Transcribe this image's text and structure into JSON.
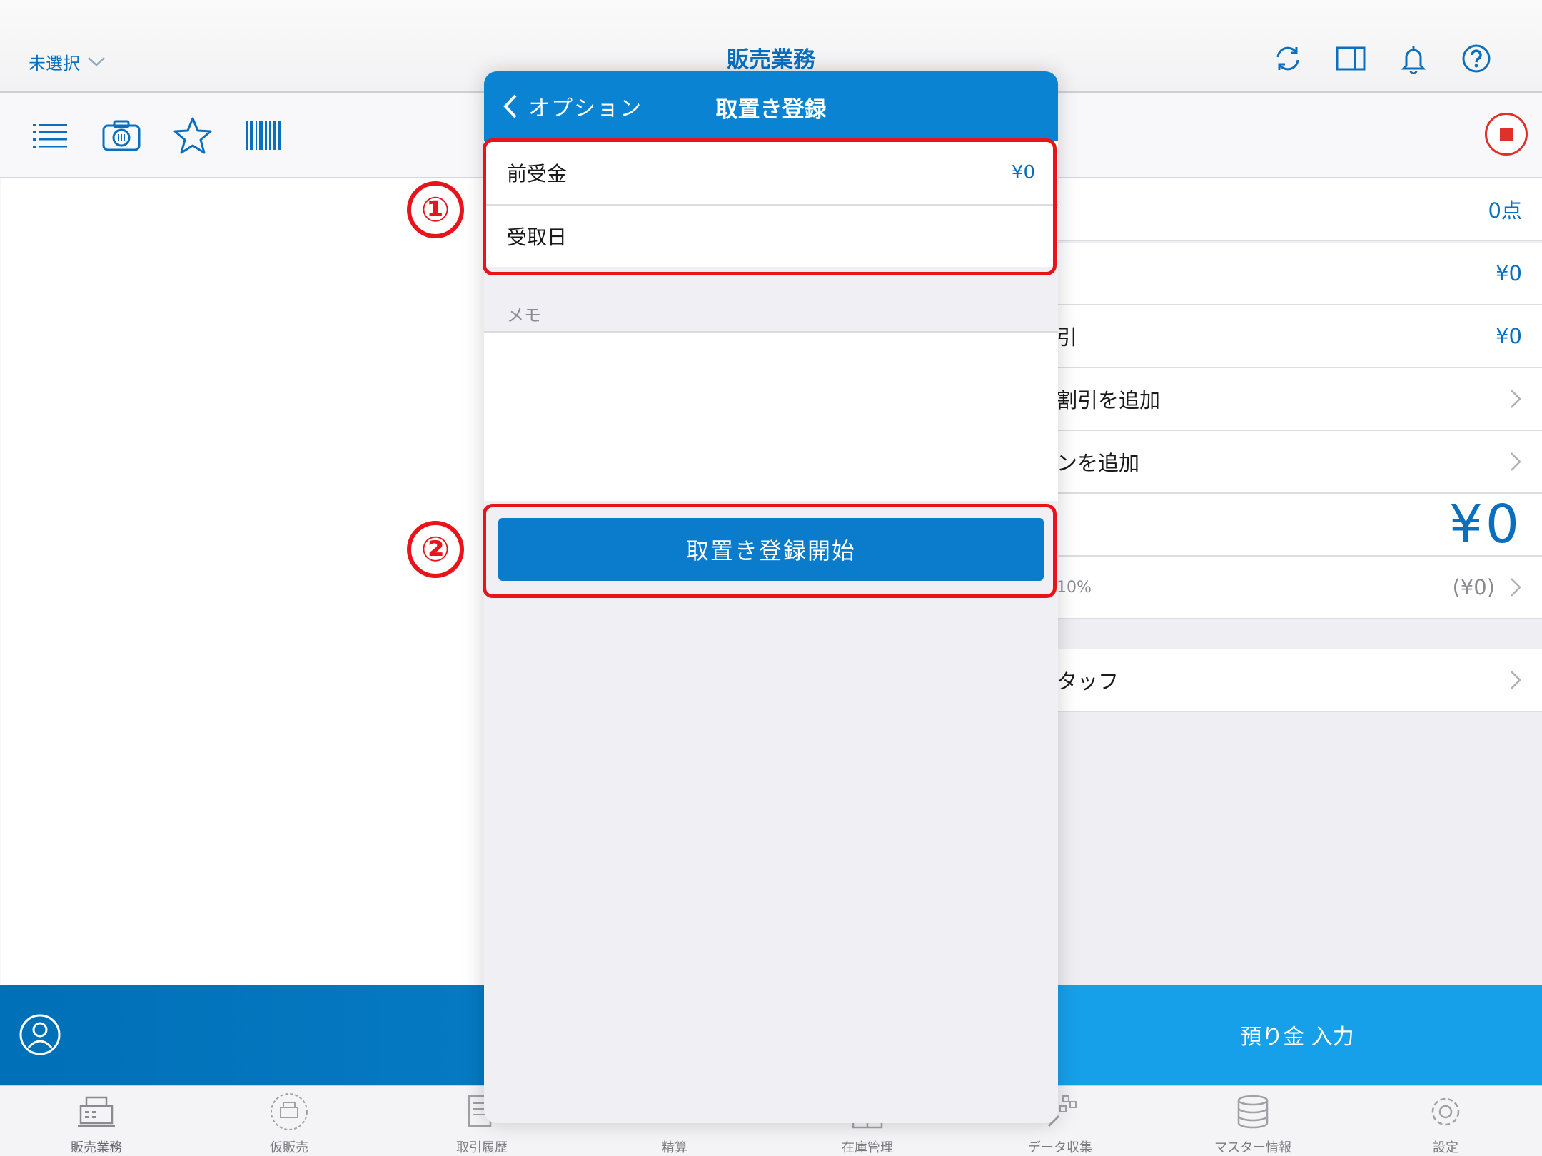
{
  "header": {
    "store_select": "未選択",
    "title": "販売業務"
  },
  "top_icons": [
    "refresh-icon",
    "split-view-icon",
    "bell-icon",
    "help-icon"
  ],
  "toolbar_icons": [
    "list-icon",
    "camera-icon",
    "star-icon",
    "barcode-icon"
  ],
  "summary": {
    "count": "0点",
    "subtotal": "¥0",
    "discount_label": "引",
    "discount_value": "¥0",
    "add_discount_label": "割引を追加",
    "add_option_label": "ンを追加",
    "total": "¥0",
    "tax_label": "10%",
    "tax_value": "(¥0)",
    "staff_label": "タッフ"
  },
  "action_bar": {
    "deposit_label": "預り金 入力"
  },
  "tabs": [
    {
      "label": "販売業務",
      "icon": "register-icon"
    },
    {
      "label": "仮販売",
      "icon": "temp-sale-icon"
    },
    {
      "label": "取引履歴",
      "icon": "history-icon"
    },
    {
      "label": "精算",
      "icon": "settlement-icon"
    },
    {
      "label": "在庫管理",
      "icon": "inventory-icon"
    },
    {
      "label": "データ収集",
      "icon": "data-collect-icon"
    },
    {
      "label": "マスター情報",
      "icon": "database-icon"
    },
    {
      "label": "設定",
      "icon": "gear-icon"
    }
  ],
  "modal": {
    "back_label": "オプション",
    "title": "取置き登録",
    "advance_label": "前受金",
    "advance_value": "¥0",
    "pickup_label": "受取日",
    "memo_label": "メモ",
    "start_button": "取置き登録開始"
  },
  "annotations": {
    "marker_1": "①",
    "marker_2": "②"
  },
  "colors": {
    "accent": "#0a84d2",
    "annotation": "#e8141a",
    "stop": "#e0302a"
  }
}
